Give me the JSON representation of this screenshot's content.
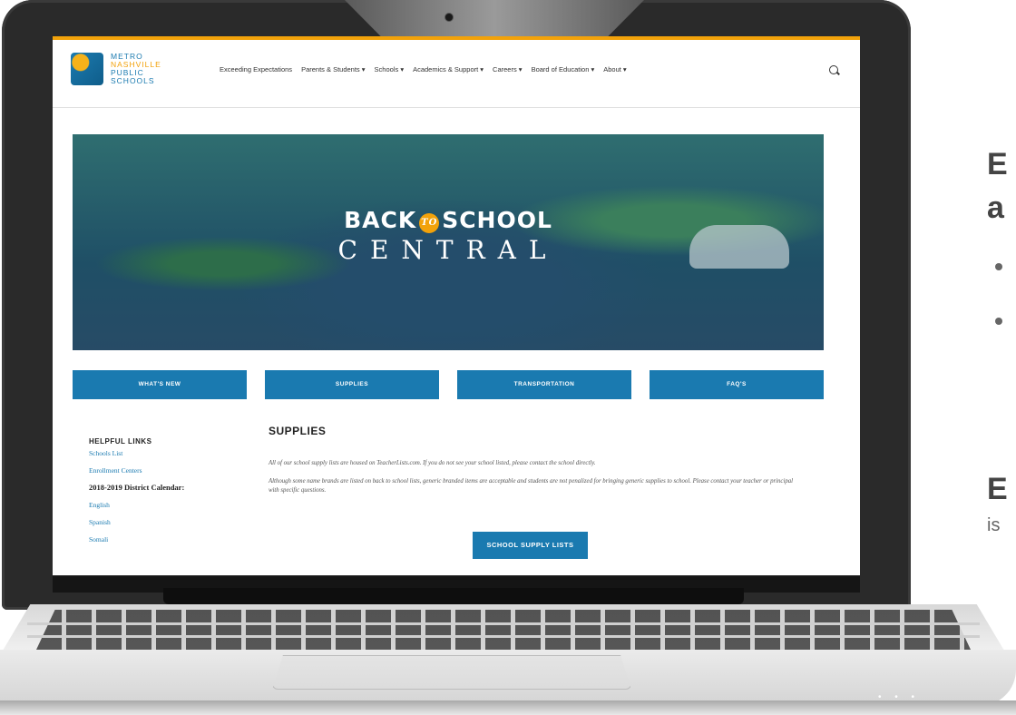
{
  "site": {
    "logo_lines": [
      "METRO",
      "NASHVILLE",
      "PUBLIC",
      "SCHOOLS"
    ],
    "nav": [
      "Exceeding Expectations",
      "Parents & Students ▾",
      "Schools ▾",
      "Academics & Support ▾",
      "Careers ▾",
      "Board of Education ▾",
      "About ▾"
    ],
    "hero": {
      "line1_left": "BACK",
      "line1_badge": "TO",
      "line1_right": "SCHOOL",
      "line2": "CENTRAL"
    },
    "buttons": [
      "WHAT'S NEW",
      "SUPPLIES",
      "TRANSPORTATION",
      "FAQ'S"
    ],
    "sidebar": {
      "heading": "HELPFUL LINKS",
      "link1": "Schools List",
      "link2": "Enrollment Centers",
      "calendar_label": "2018-2019 District Calendar:",
      "link3": "English",
      "link4": "Spanish",
      "link5": "Somali"
    },
    "content": {
      "title": "SUPPLIES",
      "paragraph1": "All of our school supply lists are housed on TeacherLists.com. If you do not see your school listed, please contact the school directly.",
      "paragraph2": "Although some name brands are listed on back to school lists, generic branded items are acceptable and students are not penalized for bringing generic supplies to school. Please contact your teacher or principal with specific questions.",
      "cta": "SCHOOL SUPPLY LISTS"
    }
  },
  "right_text": {
    "line1": "E",
    "line2": "a",
    "line3": "E",
    "line4": "is"
  },
  "device": {
    "status_dots": "• • •"
  },
  "colors": {
    "brand_blue": "#1a7ab0",
    "brand_orange": "#f2a20a"
  }
}
